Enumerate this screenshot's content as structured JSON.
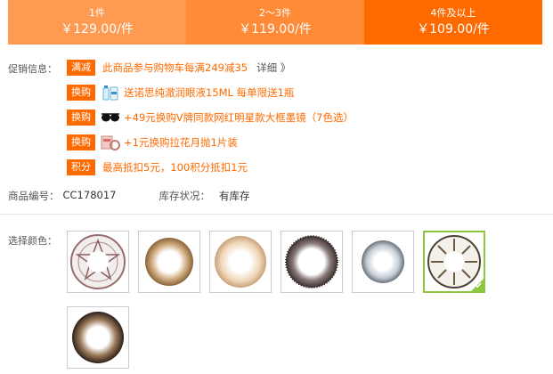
{
  "price_tiers": [
    {
      "qty": "1件",
      "price": "￥129.00/件"
    },
    {
      "qty": "2～3件",
      "price": "￥119.00/件"
    },
    {
      "qty": "4件及以上",
      "price": "￥109.00/件"
    }
  ],
  "promotion": {
    "label": "促销信息：",
    "items": [
      {
        "badge": "满减",
        "text": "此商品参与购物车每满249减35",
        "link": "详细 》",
        "icon": "none"
      },
      {
        "badge": "换购",
        "text": "送诺思纯澈润眼液15ML 每单限送1瓶",
        "icon": "eye-drop-bottle-icon"
      },
      {
        "badge": "换购",
        "text": "+49元换购V牌同款网红明星款大框墨镜（7色选）",
        "icon": "sunglasses-icon"
      },
      {
        "badge": "换购",
        "text": "+1元换购拉花月抛1片装",
        "icon": "contact-lens-box-icon"
      },
      {
        "badge": "积分",
        "text": "最高抵扣5元，100积分抵扣1元",
        "icon": "none"
      }
    ]
  },
  "product_info": {
    "sku_label": "商品编号：",
    "sku_value": "CC178017",
    "stock_label": "库存状况：",
    "stock_value": "有库存"
  },
  "color_select": {
    "label": "选择颜色：",
    "selected_index": 5,
    "options": [
      {
        "icon": "lens-star-pattern-icon",
        "accent": "#9a6b6b"
      },
      {
        "icon": "lens-brown-icon",
        "accent": "#a88058"
      },
      {
        "icon": "lens-beige-icon",
        "accent": "#c8a27a"
      },
      {
        "icon": "lens-dark-brown-icon",
        "accent": "#5a4a4a"
      },
      {
        "icon": "lens-gray-icon",
        "accent": "#8a9098"
      },
      {
        "icon": "lens-starburst-icon",
        "accent": "#6a5a44"
      },
      {
        "icon": "lens-black-brown-icon",
        "accent": "#3e2e22"
      }
    ]
  },
  "colors": {
    "accent": "#ff6a00",
    "tier_light": "#ff9a52",
    "tier_mid": "#ff8a38",
    "selected_border": "#8dc63f"
  }
}
